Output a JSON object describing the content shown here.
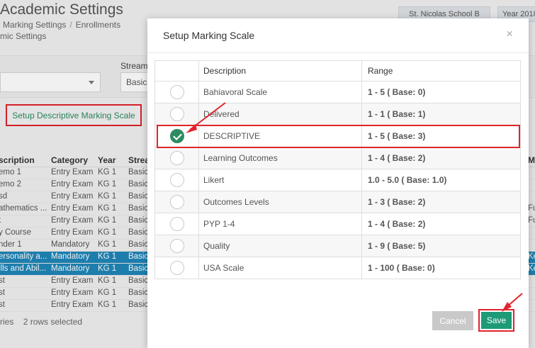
{
  "background": {
    "page_title": "Academic Settings",
    "breadcrumb": [
      "Marking Settings",
      "Enrollments"
    ],
    "sub_breadcrumb": "mic Settings",
    "school_button": "St. Nicolas School B",
    "year_button": "Year 2018",
    "stream_label": "Stream",
    "stream_value": "Basic",
    "setup_desc_button": "Setup Descriptive Marking Scale",
    "table_headers": [
      "scription",
      "Category",
      "Year",
      "Strea",
      "M"
    ],
    "rows": [
      {
        "desc": "emo 1",
        "category": "Entry Exam",
        "year": "KG 1",
        "stream": "Basic",
        "extra": "",
        "selected": false
      },
      {
        "desc": "emo 2",
        "category": "Entry Exam",
        "year": "KG 1",
        "stream": "Basic",
        "extra": "",
        "selected": false
      },
      {
        "desc": "sd",
        "category": "Entry Exam",
        "year": "KG 1",
        "stream": "Basic",
        "extra": "",
        "selected": false
      },
      {
        "desc": "athematics ...",
        "category": "Entry Exam",
        "year": "KG 1",
        "stream": "Basic",
        "extra": "Fu",
        "selected": false
      },
      {
        "desc": "t",
        "category": "Entry Exam",
        "year": "KG 1",
        "stream": "Basic",
        "extra": "Fu",
        "selected": false
      },
      {
        "desc": "y Course",
        "category": "Entry Exam",
        "year": "KG 1",
        "stream": "Basic",
        "extra": "",
        "selected": false
      },
      {
        "desc": "nder 1",
        "category": "Mandatory",
        "year": "KG 1",
        "stream": "Basic",
        "extra": "",
        "selected": false
      },
      {
        "desc": "ersonality a...",
        "category": "Mandatory",
        "year": "KG 1",
        "stream": "Basic",
        "extra": "Ke",
        "selected": true
      },
      {
        "desc": "ills and Abil...",
        "category": "Mandatory",
        "year": "KG 1",
        "stream": "Basic",
        "extra": "Ke",
        "selected": true
      },
      {
        "desc": "st",
        "category": "Entry Exam",
        "year": "KG 1",
        "stream": "Basic",
        "extra": "",
        "selected": false
      },
      {
        "desc": "st",
        "category": "Entry Exam",
        "year": "KG 1",
        "stream": "Basic",
        "extra": "",
        "selected": false
      },
      {
        "desc": "st",
        "category": "Entry Exam",
        "year": "KG 1",
        "stream": "Basic",
        "extra": "",
        "selected": false
      }
    ],
    "footer_entries": "ries",
    "footer_selected": "2 rows selected"
  },
  "modal": {
    "title": "Setup Marking Scale",
    "close_symbol": "×",
    "col_description": "Description",
    "col_range": "Range",
    "scales": [
      {
        "description": "Bahiavoral Scale",
        "range": "1 - 5 ( Base: 0)",
        "selected": false
      },
      {
        "description": "Delivered",
        "range": "1 - 1 ( Base: 1)",
        "selected": false
      },
      {
        "description": "DESCRIPTIVE",
        "range": "1 - 5 ( Base: 3)",
        "selected": true
      },
      {
        "description": "Learning Outcomes",
        "range": "1 - 4 ( Base: 2)",
        "selected": false
      },
      {
        "description": "Likert",
        "range": "1.0 - 5.0 ( Base: 1.0)",
        "selected": false
      },
      {
        "description": "Outcomes Levels",
        "range": "1 - 3 ( Base: 2)",
        "selected": false
      },
      {
        "description": "PYP 1-4",
        "range": "1 - 4 ( Base: 2)",
        "selected": false
      },
      {
        "description": "Quality",
        "range": "1 - 9 ( Base: 5)",
        "selected": false
      },
      {
        "description": "USA Scale",
        "range": "1 - 100 ( Base: 0)",
        "selected": false
      }
    ],
    "cancel_label": "Cancel",
    "save_label": "Save"
  },
  "colors": {
    "accent": "#2e8b61",
    "save": "#1e9a78",
    "annotation_red": "#e0242b",
    "row_selected": "#1f86b8"
  }
}
